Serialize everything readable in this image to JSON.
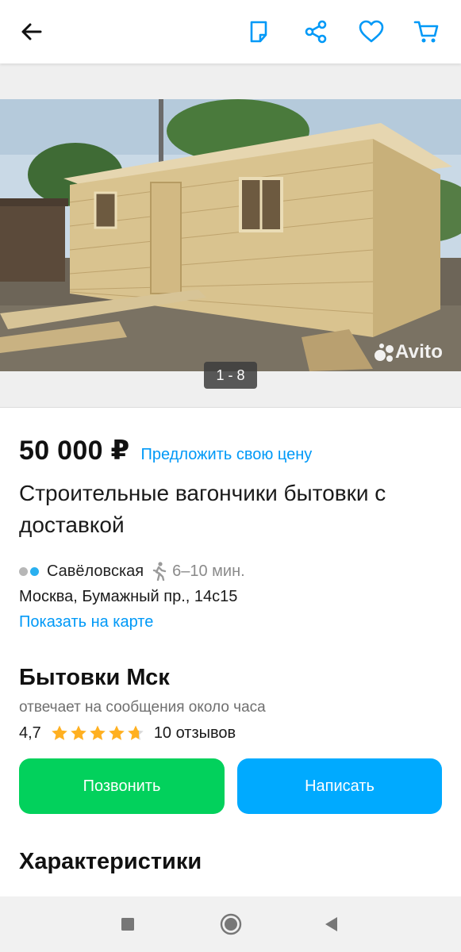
{
  "colors": {
    "accent": "#0099f7",
    "call": "#02d15c",
    "write": "#00aaff",
    "star": "#ffb021"
  },
  "header": {
    "icons": [
      "arrow-left-icon",
      "note-icon",
      "share-icon",
      "heart-icon",
      "cart-icon"
    ]
  },
  "gallery": {
    "counter": "1 - 8",
    "watermark": "Avito"
  },
  "listing": {
    "price": "50 000 ₽",
    "offer_link": "Предложить свою цену",
    "title": "Строительные вагончики бытовки с доставкой",
    "metro_station": "Савёловская",
    "walk_time": "6–10 мин.",
    "address": "Москва, Бумажный пр., 14с15",
    "show_on_map": "Показать на карте"
  },
  "seller": {
    "name": "Бытовки Мск",
    "responds": "отвечает на сообщения около часа",
    "rating_text": "4,7",
    "rating_value": 4.7,
    "reviews": "10 отзывов"
  },
  "actions": {
    "call": "Позвонить",
    "write": "Написать"
  },
  "specs": {
    "heading": "Характеристики"
  }
}
